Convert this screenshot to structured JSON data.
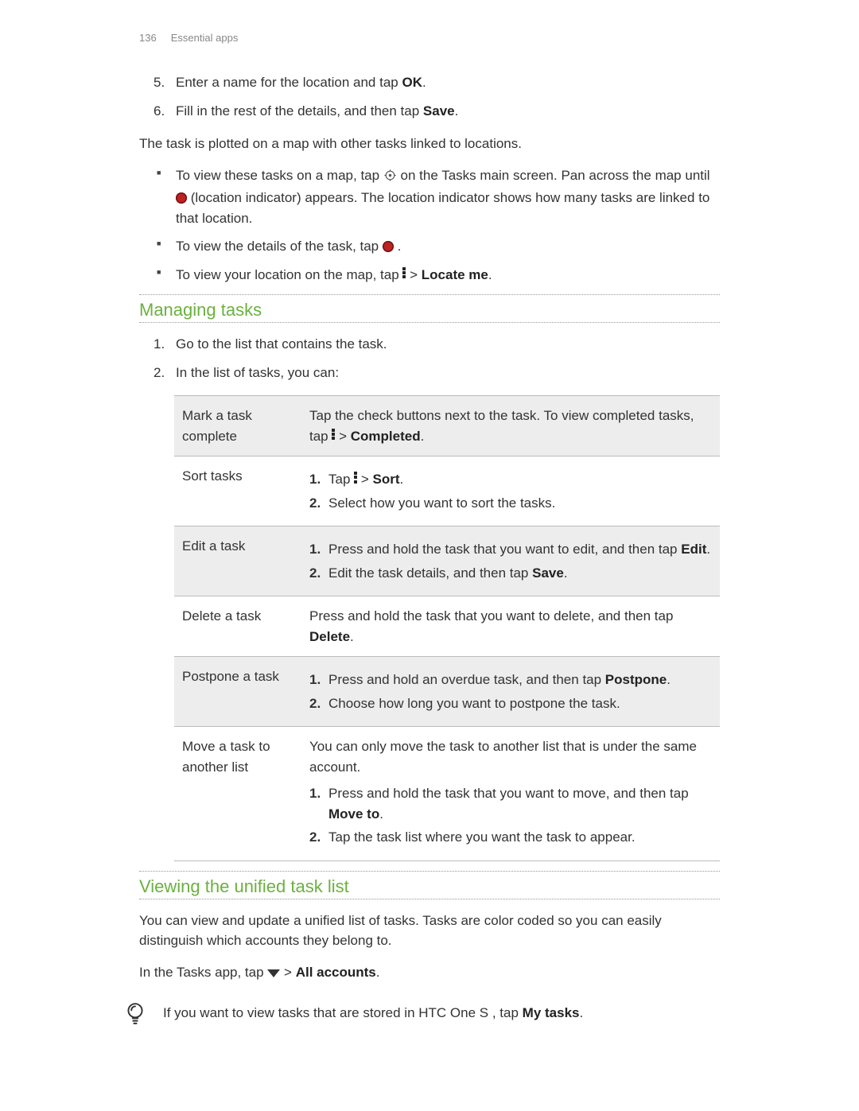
{
  "header": {
    "page_number": "136",
    "section": "Essential apps"
  },
  "steps_top": [
    {
      "n": "5.",
      "pre": "Enter a name for the location and tap ",
      "bold": "OK",
      "post": "."
    },
    {
      "n": "6.",
      "pre": "Fill in the rest of the details, and then tap ",
      "bold": "Save",
      "post": "."
    }
  ],
  "map_intro": "The task is plotted on a map with other tasks linked to locations.",
  "map_bullets": {
    "b1a": "To view these tasks on a map, tap ",
    "b1b": " on the Tasks main screen. Pan across the map until ",
    "b1c": " (location indicator) appears. The location indicator shows how many tasks are linked to that location.",
    "b2a": "To view the details of the task, tap ",
    "b2b": " .",
    "b3a": "To view your location on the map, tap ",
    "b3b": " > ",
    "b3bold": "Locate me",
    "b3c": "."
  },
  "managing": {
    "title": "Managing tasks",
    "steps": [
      {
        "n": "1.",
        "text": "Go to the list that contains the task."
      },
      {
        "n": "2.",
        "text": "In the list of tasks, you can:"
      }
    ],
    "table": {
      "r1": {
        "label": "Mark a task complete",
        "pre": "Tap the check buttons next to the task. To view completed tasks, tap ",
        "mid": " > ",
        "bold": "Completed",
        "post": "."
      },
      "r2": {
        "label": "Sort tasks",
        "s1a": "Tap ",
        "s1b": " > ",
        "s1bold": "Sort",
        "s1c": ".",
        "s2": "Select how you want to sort the tasks."
      },
      "r3": {
        "label": "Edit a task",
        "s1a": "Press and hold the task that you want to edit, and then tap ",
        "s1bold": "Edit",
        "s1b": ".",
        "s2a": "Edit the task details, and then tap ",
        "s2bold": "Save",
        "s2b": "."
      },
      "r4": {
        "label": "Delete a task",
        "pre": "Press and hold the task that you want to delete, and then tap ",
        "bold": "Delete",
        "post": "."
      },
      "r5": {
        "label": "Postpone a task",
        "s1a": "Press and hold an overdue task, and then tap ",
        "s1bold": "Postpone",
        "s1b": ".",
        "s2": "Choose how long you want to postpone the task."
      },
      "r6": {
        "label": "Move a task to another list",
        "intro": "You can only move the task to another list that is under the same account.",
        "s1a": "Press and hold the task that you want to move, and then tap ",
        "s1bold": "Move to",
        "s1b": ".",
        "s2": "Tap the task list where you want the task to appear."
      }
    }
  },
  "unified": {
    "title": "Viewing the unified task list",
    "p1": "You can view and update a unified list of tasks. Tasks are color coded so you can easily distinguish which accounts they belong to.",
    "p2a": "In the Tasks app, tap ",
    "p2b": " > ",
    "p2bold": "All accounts",
    "p2c": "."
  },
  "tip": {
    "pre": "If you want to view tasks that are stored in HTC One S , tap ",
    "bold": "My tasks",
    "post": "."
  }
}
